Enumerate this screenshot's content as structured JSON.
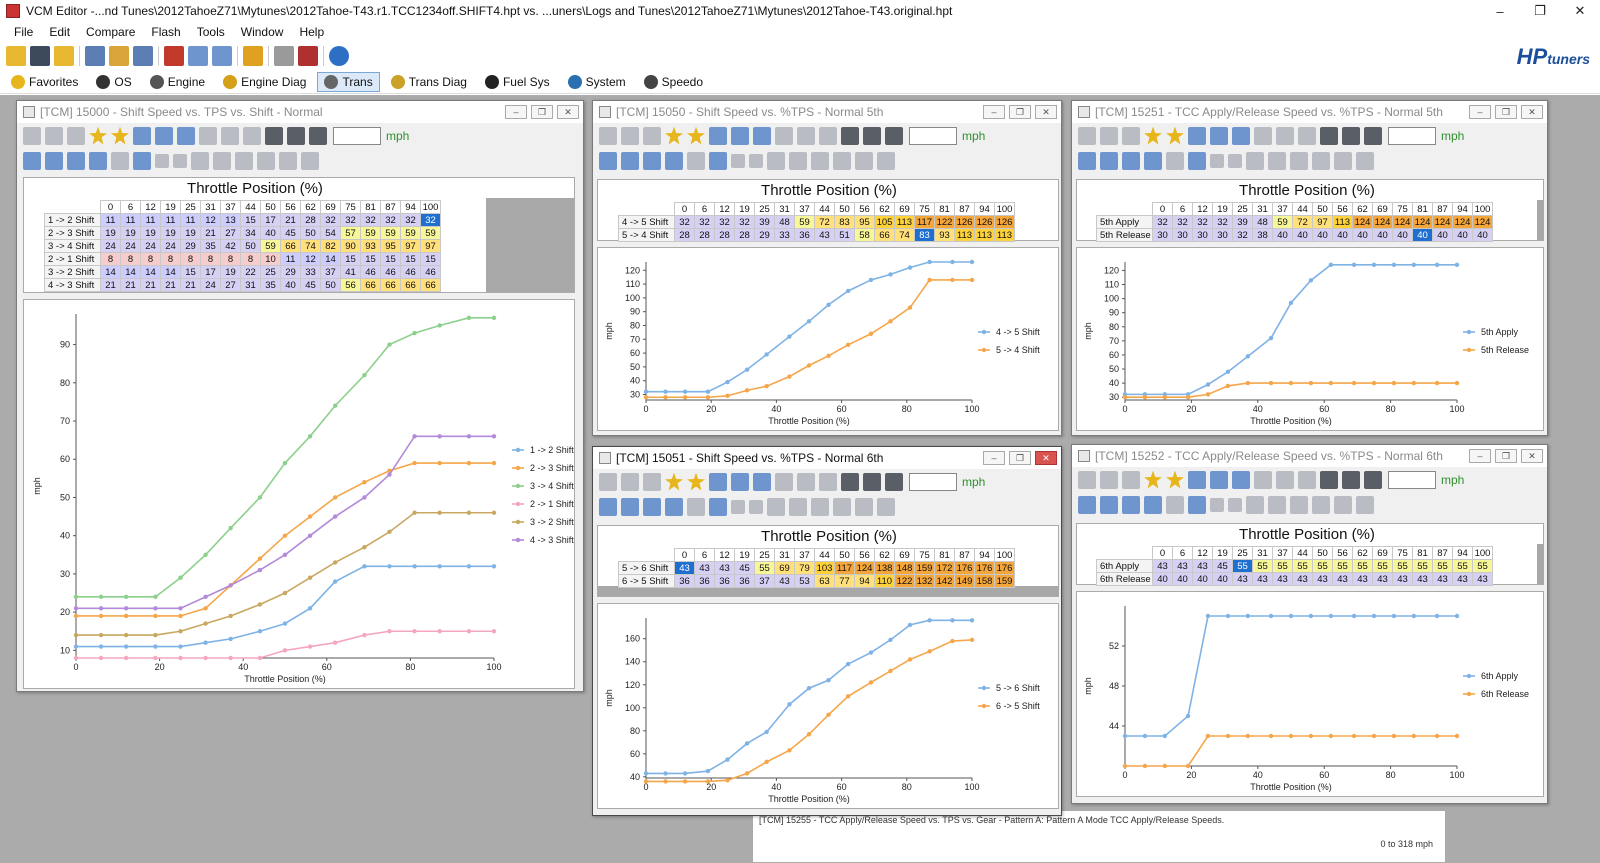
{
  "window": {
    "title": "VCM Editor -...nd Tunes\\2012TahoeZ71\\Mytunes\\2012Tahoe-T43.r1.TCC1234off.SHIFT4.hpt vs. ...uners\\Logs and Tunes\\2012TahoeZ71\\Mytunes\\2012Tahoe-T43.original.hpt"
  },
  "menu": [
    "File",
    "Edit",
    "Compare",
    "Flash",
    "Tools",
    "Window",
    "Help"
  ],
  "logo": {
    "main": "HP",
    "sub": "tuners"
  },
  "nav": [
    {
      "label": "Favorites",
      "icon": "star-icon",
      "color": "#e7b61c"
    },
    {
      "label": "OS",
      "icon": "chip-icon",
      "color": "#333333"
    },
    {
      "label": "Engine",
      "icon": "engine-icon",
      "color": "#555555"
    },
    {
      "label": "Engine Diag",
      "icon": "engine-diag-icon",
      "color": "#d4a017"
    },
    {
      "label": "Trans",
      "icon": "gear-icon",
      "color": "#666666"
    },
    {
      "label": "Trans Diag",
      "icon": "gear-diag-icon",
      "color": "#c9a227"
    },
    {
      "label": "Fuel Sys",
      "icon": "fuel-pump-icon",
      "color": "#222222"
    },
    {
      "label": "System",
      "icon": "system-icon",
      "color": "#2a6fb0"
    },
    {
      "label": "Speedo",
      "icon": "speedo-icon",
      "color": "#444444"
    }
  ],
  "active_nav": "Trans",
  "unit": "mph",
  "table_axis_title": "Throttle Position (%)",
  "tps_cols": [
    "0",
    "6",
    "12",
    "19",
    "25",
    "31",
    "37",
    "44",
    "50",
    "56",
    "62",
    "69",
    "75",
    "81",
    "87",
    "94",
    "100"
  ],
  "windows": [
    {
      "id": "w15000",
      "title": "[TCM] 15000 - Shift Speed vs. TPS vs. Shift - Normal",
      "rows": [
        {
          "label": "1 -> 2 Shift",
          "values": [
            11,
            11,
            11,
            11,
            11,
            12,
            13,
            15,
            17,
            21,
            28,
            32,
            32,
            32,
            32,
            32,
            32
          ]
        },
        {
          "label": "2 -> 3 Shift",
          "values": [
            19,
            19,
            19,
            19,
            19,
            21,
            27,
            34,
            40,
            45,
            50,
            54,
            57,
            59,
            59,
            59,
            59
          ]
        },
        {
          "label": "3 -> 4 Shift",
          "values": [
            24,
            24,
            24,
            24,
            29,
            35,
            42,
            50,
            59,
            66,
            74,
            82,
            90,
            93,
            95,
            97,
            97
          ]
        },
        {
          "label": "2 -> 1 Shift",
          "values": [
            8,
            8,
            8,
            8,
            8,
            8,
            8,
            8,
            10,
            11,
            12,
            14,
            15,
            15,
            15,
            15,
            15
          ]
        },
        {
          "label": "3 -> 2 Shift",
          "values": [
            14,
            14,
            14,
            14,
            15,
            17,
            19,
            22,
            25,
            29,
            33,
            37,
            41,
            46,
            46,
            46,
            46
          ]
        },
        {
          "label": "4 -> 3 Shift",
          "values": [
            21,
            21,
            21,
            21,
            21,
            24,
            27,
            31,
            35,
            40,
            45,
            50,
            56,
            66,
            66,
            66,
            66
          ]
        }
      ],
      "chart": {
        "type": "line",
        "xlabel": "Throttle Position (%)",
        "ylabel": "mph",
        "xlim": [
          0,
          100
        ],
        "ylim": [
          8,
          98
        ],
        "xticks": [
          0,
          20,
          40,
          60,
          80,
          100
        ],
        "yticks": [
          10,
          20,
          30,
          40,
          50,
          60,
          70,
          80,
          90
        ]
      }
    },
    {
      "id": "w15050",
      "title": "[TCM] 15050 - Shift Speed vs. %TPS - Normal 5th",
      "rows": [
        {
          "label": "4 -> 5 Shift",
          "values": [
            32,
            32,
            32,
            32,
            39,
            48,
            59,
            72,
            83,
            95,
            105,
            113,
            117,
            122,
            126,
            126,
            126
          ]
        },
        {
          "label": "5 -> 4 Shift",
          "values": [
            28,
            28,
            28,
            28,
            29,
            33,
            36,
            43,
            51,
            58,
            66,
            74,
            83,
            93,
            113,
            113,
            113
          ]
        }
      ],
      "chart": {
        "type": "line",
        "xlabel": "Throttle Position (%)",
        "ylabel": "mph",
        "xlim": [
          0,
          100
        ],
        "ylim": [
          26,
          126
        ],
        "xticks": [
          0,
          20,
          40,
          60,
          80,
          100
        ],
        "yticks": [
          30,
          40,
          50,
          60,
          70,
          80,
          90,
          100,
          110,
          120
        ]
      }
    },
    {
      "id": "w15251",
      "title": "[TCM] 15251 - TCC Apply/Release Speed vs. %TPS - Normal 5th",
      "rows": [
        {
          "label": "5th Apply",
          "values": [
            32,
            32,
            32,
            32,
            39,
            48,
            59,
            72,
            97,
            113,
            124,
            124,
            124,
            124,
            124,
            124,
            124
          ]
        },
        {
          "label": "5th Release",
          "values": [
            30,
            30,
            30,
            30,
            32,
            38,
            40,
            40,
            40,
            40,
            40,
            40,
            40,
            40,
            40,
            40,
            40
          ]
        }
      ],
      "chart": {
        "type": "line",
        "xlabel": "Throttle Position (%)",
        "ylabel": "mph",
        "xlim": [
          0,
          100
        ],
        "ylim": [
          28,
          126
        ],
        "xticks": [
          0,
          20,
          40,
          60,
          80,
          100
        ],
        "yticks": [
          30,
          40,
          50,
          60,
          70,
          80,
          90,
          100,
          110,
          120
        ]
      }
    },
    {
      "id": "w15051",
      "title": "[TCM] 15051 - Shift Speed vs. %TPS - Normal 6th",
      "rows": [
        {
          "label": "5 -> 6 Shift",
          "values": [
            43,
            43,
            43,
            45,
            55,
            69,
            79,
            103,
            117,
            124,
            138,
            148,
            159,
            172,
            176,
            176,
            176
          ]
        },
        {
          "label": "6 -> 5 Shift",
          "values": [
            36,
            36,
            36,
            36,
            37,
            43,
            53,
            63,
            77,
            94,
            110,
            122,
            132,
            142,
            149,
            158,
            159
          ]
        }
      ],
      "chart": {
        "type": "line",
        "xlabel": "Throttle Position (%)",
        "ylabel": "mph",
        "xlim": [
          0,
          100
        ],
        "ylim": [
          39,
          178
        ],
        "xticks": [
          0,
          20,
          40,
          60,
          80,
          100
        ],
        "yticks": [
          40,
          60,
          80,
          100,
          120,
          140,
          160
        ]
      }
    },
    {
      "id": "w15252",
      "title": "[TCM] 15252 - TCC Apply/Release Speed vs. %TPS - Normal 6th",
      "rows": [
        {
          "label": "6th Apply",
          "values": [
            43,
            43,
            43,
            45,
            55,
            55,
            55,
            55,
            55,
            55,
            55,
            55,
            55,
            55,
            55,
            55,
            55
          ]
        },
        {
          "label": "6th Release",
          "values": [
            40,
            40,
            40,
            40,
            43,
            43,
            43,
            43,
            43,
            43,
            43,
            43,
            43,
            43,
            43,
            43,
            43
          ]
        }
      ],
      "chart": {
        "type": "line",
        "xlabel": "Throttle Position (%)",
        "ylabel": "mph",
        "xlim": [
          0,
          100
        ],
        "ylim": [
          40,
          56
        ],
        "xticks": [
          0,
          20,
          40,
          60,
          80,
          100
        ],
        "yticks": [
          44,
          48,
          52
        ]
      }
    }
  ],
  "series_colors": [
    "#7fb2e5",
    "#f5a64a",
    "#8cd08c",
    "#f4a6c0",
    "#c8a860",
    "#b28ad8"
  ],
  "bottom": {
    "message": "[TCM] 15255 - TCC Apply/Release Speed vs. TPS vs. Gear - Pattern A: Pattern A Mode TCC Apply/Release Speeds.",
    "range": "0 to 318 mph"
  }
}
